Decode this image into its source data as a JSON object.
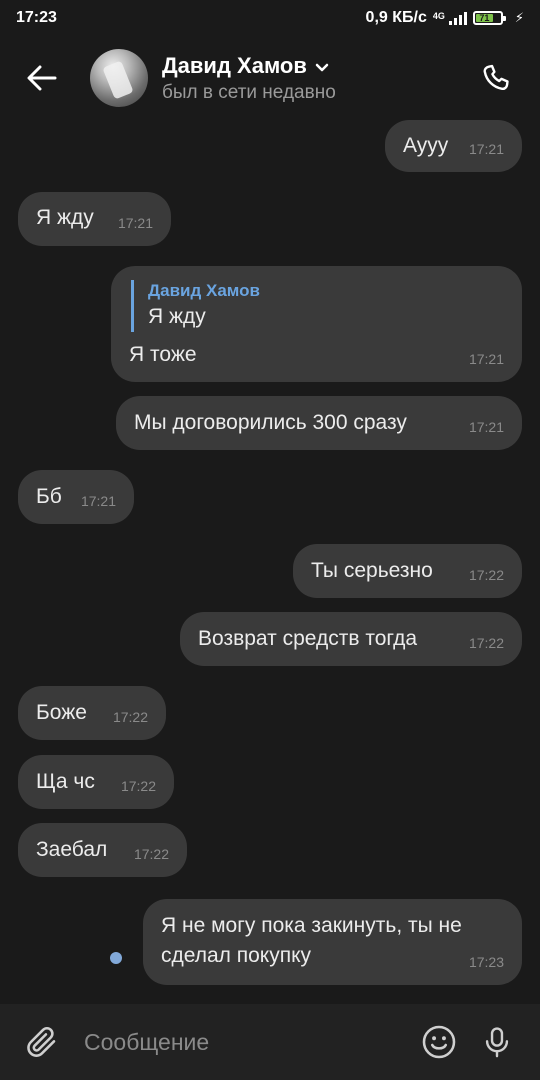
{
  "status_bar": {
    "time": "17:23",
    "speed": "0,9 КБ/с",
    "network": "4G",
    "battery": "71"
  },
  "header": {
    "contact_name": "Давид Хамов",
    "last_seen": "был в сети недавно"
  },
  "messages": [
    {
      "direction": "out",
      "text": "Аууу",
      "time": "17:21"
    },
    {
      "direction": "in",
      "text": "Я жду",
      "time": "17:21"
    },
    {
      "direction": "out",
      "reply_author": "Давид Хамов",
      "reply_text": "Я жду",
      "text": "Я тоже",
      "time": "17:21"
    },
    {
      "direction": "out",
      "text": "Мы договорились 300 сразу",
      "time": "17:21"
    },
    {
      "direction": "in",
      "text": "Бб",
      "time": "17:21"
    },
    {
      "direction": "out",
      "text": "Ты серьезно",
      "time": "17:22"
    },
    {
      "direction": "out",
      "text": "Возврат средств тогда",
      "time": "17:22"
    },
    {
      "direction": "in",
      "text": "Боже",
      "time": "17:22"
    },
    {
      "direction": "in",
      "text": "Ща чс",
      "time": "17:22"
    },
    {
      "direction": "in",
      "text": "Заебал",
      "time": "17:22"
    },
    {
      "direction": "out",
      "lines": [
        "Я не могу пока закинуть, ты не",
        "сделал покупку"
      ],
      "time": "17:23",
      "unread": true
    }
  ],
  "composer": {
    "placeholder": "Сообщение"
  },
  "colors": {
    "background": "#1a1a1a",
    "bubble": "#3a3a3a",
    "accent": "#6aa4e0",
    "composer": "#222222"
  },
  "icons": [
    "back-arrow-icon",
    "chevron-down-icon",
    "phone-icon",
    "paperclip-icon",
    "smiley-icon",
    "microphone-icon"
  ]
}
